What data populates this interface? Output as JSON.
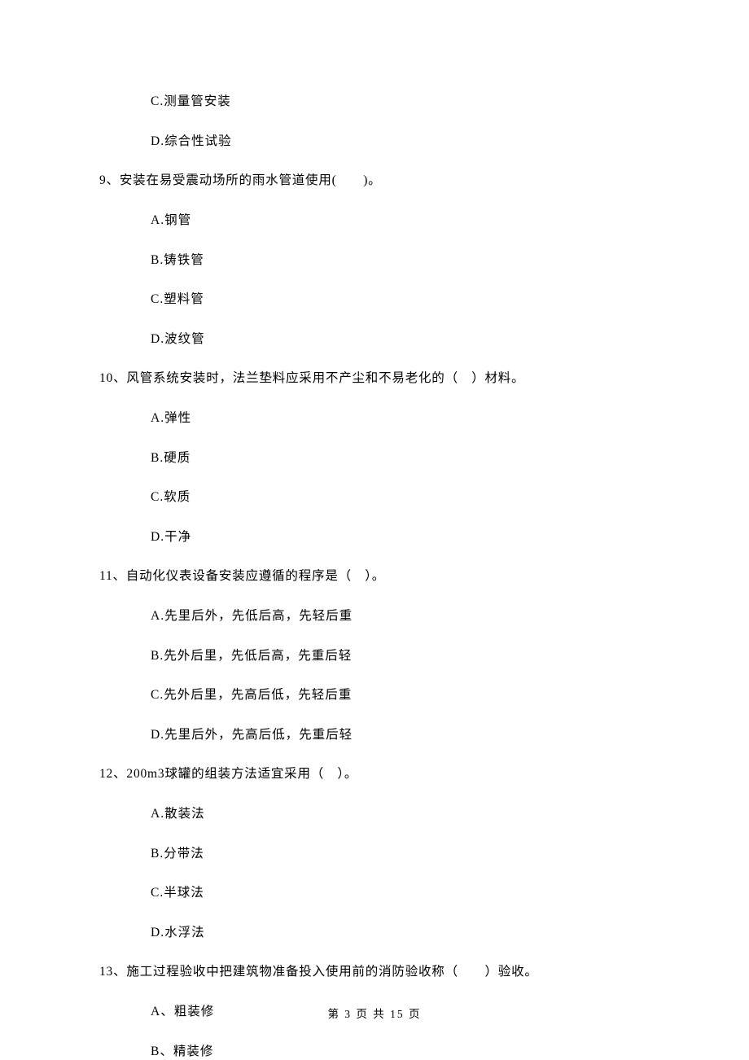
{
  "fragment_options_top": [
    "C.测量管安装",
    "D.综合性试验"
  ],
  "questions": [
    {
      "number": "9、",
      "text": "安装在易受震动场所的雨水管道使用(　　)。",
      "options": [
        "A.钢管",
        "B.铸铁管",
        "C.塑料管",
        "D.波纹管"
      ]
    },
    {
      "number": "10、",
      "text": "风管系统安装时，法兰垫料应采用不产尘和不易老化的（　）材料。",
      "options": [
        "A.弹性",
        "B.硬质",
        "C.软质",
        "D.干净"
      ]
    },
    {
      "number": "11、",
      "text": "自动化仪表设备安装应遵循的程序是（　）。",
      "options": [
        "A.先里后外，先低后高，先轻后重",
        "B.先外后里，先低后高，先重后轻",
        "C.先外后里，先高后低，先轻后重",
        "D.先里后外，先高后低，先重后轻"
      ]
    },
    {
      "number": "12、",
      "text": "200m3球罐的组装方法适宜采用（　）。",
      "options": [
        "A.散装法",
        "B.分带法",
        "C.半球法",
        "D.水浮法"
      ]
    },
    {
      "number": "13、",
      "text": "施工过程验收中把建筑物准备投入使用前的消防验收称（　　）验收。",
      "options": [
        "A、粗装修",
        "B、精装修"
      ]
    }
  ],
  "footer": "第 3 页 共 15 页"
}
